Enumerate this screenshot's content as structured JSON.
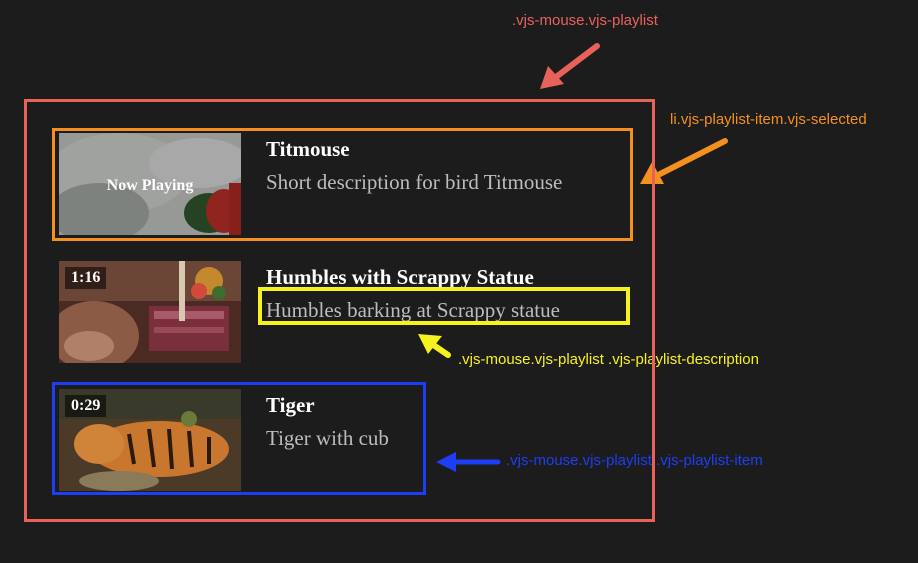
{
  "annotations": {
    "playlist": {
      "label": ".vjs-mouse.vjs-playlist",
      "color": "#e8625a"
    },
    "selected": {
      "label": "li.vjs-playlist-item.vjs-selected",
      "color": "#f5901e"
    },
    "description": {
      "label": ".vjs-mouse.vjs-playlist .vjs-playlist-description",
      "color": "#f6f21c"
    },
    "item": {
      "label": ".vjs-mouse.vjs-playlist .vjs-playlist-item",
      "color": "#1d3ef5"
    }
  },
  "playlist": {
    "items": [
      {
        "title": "Titmouse",
        "description": "Short description for bird Titmouse",
        "overlay": "Now Playing",
        "selected": true
      },
      {
        "title": "Humbles with Scrappy Statue",
        "description": "Humbles barking at Scrappy statue",
        "duration": "1:16"
      },
      {
        "title": "Tiger",
        "description": "Tiger with cub",
        "duration": "0:29"
      }
    ]
  }
}
